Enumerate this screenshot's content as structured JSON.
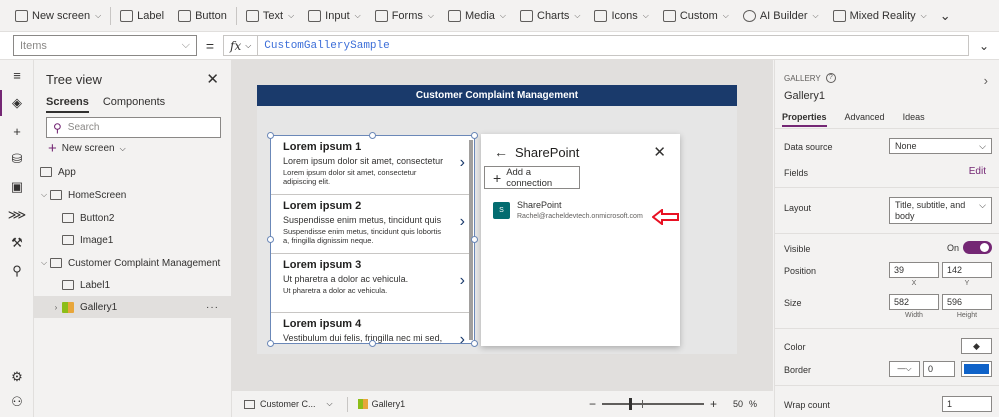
{
  "ribbon": {
    "items": [
      {
        "label": "New screen",
        "icon": "new-screen-icon",
        "has_chevron": true
      },
      {
        "label": "Label",
        "icon": "label-icon",
        "has_chevron": false
      },
      {
        "label": "Button",
        "icon": "button-icon",
        "has_chevron": false
      },
      {
        "label": "Text",
        "icon": "text-icon",
        "has_chevron": true
      },
      {
        "label": "Input",
        "icon": "input-icon",
        "has_chevron": true
      },
      {
        "label": "Forms",
        "icon": "forms-icon",
        "has_chevron": true
      },
      {
        "label": "Media",
        "icon": "media-icon",
        "has_chevron": true
      },
      {
        "label": "Charts",
        "icon": "charts-icon",
        "has_chevron": true
      },
      {
        "label": "Icons",
        "icon": "icons-icon",
        "has_chevron": true
      },
      {
        "label": "Custom",
        "icon": "custom-icon",
        "has_chevron": true
      },
      {
        "label": "AI Builder",
        "icon": "ai-builder-icon",
        "has_chevron": true
      },
      {
        "label": "Mixed Reality",
        "icon": "mixed-reality-icon",
        "has_chevron": true
      }
    ]
  },
  "formula_bar": {
    "property": "Items",
    "equals": "=",
    "fx": "fx",
    "formula": "CustomGallerySample"
  },
  "tree_view": {
    "title": "Tree view",
    "tabs": [
      "Screens",
      "Components"
    ],
    "active_tab": "Screens",
    "search_placeholder": "Search",
    "new_screen": "New screen",
    "items": [
      {
        "label": "App",
        "level": 0
      },
      {
        "label": "HomeScreen",
        "level": 0
      },
      {
        "label": "Button2",
        "level": 1
      },
      {
        "label": "Image1",
        "level": 1
      },
      {
        "label": "Customer Complaint Management",
        "level": 0
      },
      {
        "label": "Label1",
        "level": 1
      },
      {
        "label": "Gallery1",
        "level": 1,
        "selected": true,
        "more": "···"
      }
    ]
  },
  "canvas": {
    "header": "Customer Complaint Management",
    "gallery_items": [
      {
        "title": "Lorem ipsum 1",
        "subtitle": "Lorem ipsum dolor sit amet, consectetur",
        "body": "Lorem ipsum dolor sit amet, consectetur adipiscing elit."
      },
      {
        "title": "Lorem ipsum 2",
        "subtitle": "Suspendisse enim metus, tincidunt quis",
        "body": "Suspendisse enim metus, tincidunt quis lobortis a, fringilla dignissim neque."
      },
      {
        "title": "Lorem ipsum 3",
        "subtitle": "Ut pharetra a dolor ac vehicula.",
        "body": "Ut pharetra a dolor ac vehicula."
      },
      {
        "title": "Lorem ipsum 4",
        "subtitle": "Vestibulum dui felis, fringilla nec mi sed,",
        "body": ""
      }
    ]
  },
  "sharepoint_panel": {
    "title": "SharePoint",
    "add_connection": "Add a connection",
    "connection": {
      "name": "SharePoint",
      "email": "Rachel@racheldevtech.onmicrosoft.com",
      "logo_text": "S"
    }
  },
  "status_bar": {
    "screen": "Customer C...",
    "control": "Gallery1",
    "zoom_minus": "−",
    "zoom_plus": "+",
    "zoom_value": "50",
    "zoom_unit": "%"
  },
  "properties": {
    "kind": "GALLERY",
    "name": "Gallery1",
    "tabs": [
      "Properties",
      "Advanced",
      "Ideas"
    ],
    "active_tab": "Properties",
    "data_source_label": "Data source",
    "data_source": "None",
    "fields_label": "Fields",
    "fields_edit": "Edit",
    "layout_label": "Layout",
    "layout": "Title, subtitle, and body",
    "visible_label": "Visible",
    "visible_state": "On",
    "position_label": "Position",
    "position_x": "39",
    "position_y": "142",
    "x_label": "X",
    "y_label": "Y",
    "size_label": "Size",
    "width": "582",
    "height": "596",
    "width_label": "Width",
    "height_label": "Height",
    "color_label": "Color",
    "border_label": "Border",
    "border_width": "0",
    "border_color": "#0f62c8",
    "wrap_count_label": "Wrap count",
    "wrap_count": "1"
  },
  "colors": {
    "accent": "#742774",
    "header_bg": "#1a3a6b",
    "annotation_arrow": "#e81123"
  }
}
